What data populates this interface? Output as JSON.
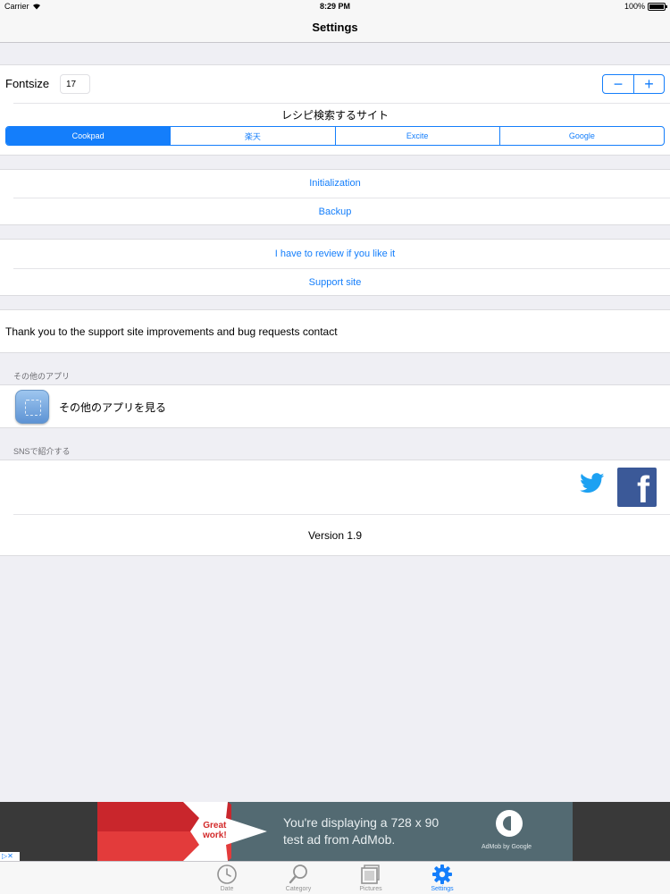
{
  "status_bar": {
    "carrier": "Carrier",
    "time": "8:29 PM",
    "battery": "100%",
    "battery_level": 1.0
  },
  "nav": {
    "title": "Settings"
  },
  "font_settings": {
    "label": "Fontsize",
    "value": "17",
    "decrement_symbol": "−",
    "increment_symbol": "+",
    "recipe_site_title": "レシピ検索するサイト",
    "sites": [
      {
        "label": "Cookpad",
        "selected": true
      },
      {
        "label": "楽天",
        "selected": false
      },
      {
        "label": "Excite",
        "selected": false
      },
      {
        "label": "Google",
        "selected": false
      }
    ]
  },
  "data_actions": {
    "initialization": "Initialization",
    "backup": "Backup"
  },
  "support_actions": {
    "review": "I have to review if you like it",
    "support_site": "Support site"
  },
  "thanks_text": "Thank you to the support site improvements and bug requests contact",
  "other_apps": {
    "header": "その他のアプリ",
    "label": "その他のアプリを見る"
  },
  "sns": {
    "header": "SNSで紹介する",
    "facebook_glyph": "f"
  },
  "version": "Version 1.9",
  "ad": {
    "badge_line1": "Great",
    "badge_line2": "work!",
    "line1": "You're displaying a 728 x 90",
    "line2": "test ad from AdMob.",
    "brand": "AdMob by Google",
    "choice_glyph": "▷✕"
  },
  "tabs": [
    {
      "label": "Date",
      "icon": "clock-icon",
      "active": false
    },
    {
      "label": "Category",
      "icon": "magnifier-icon",
      "active": false
    },
    {
      "label": "Pictures",
      "icon": "pictures-icon",
      "active": false
    },
    {
      "label": "Settings",
      "icon": "gear-icon",
      "active": true
    }
  ],
  "colors": {
    "accent": "#147efb",
    "facebook": "#3b5998",
    "twitter": "#1da1f2",
    "background": "#efeff4"
  }
}
